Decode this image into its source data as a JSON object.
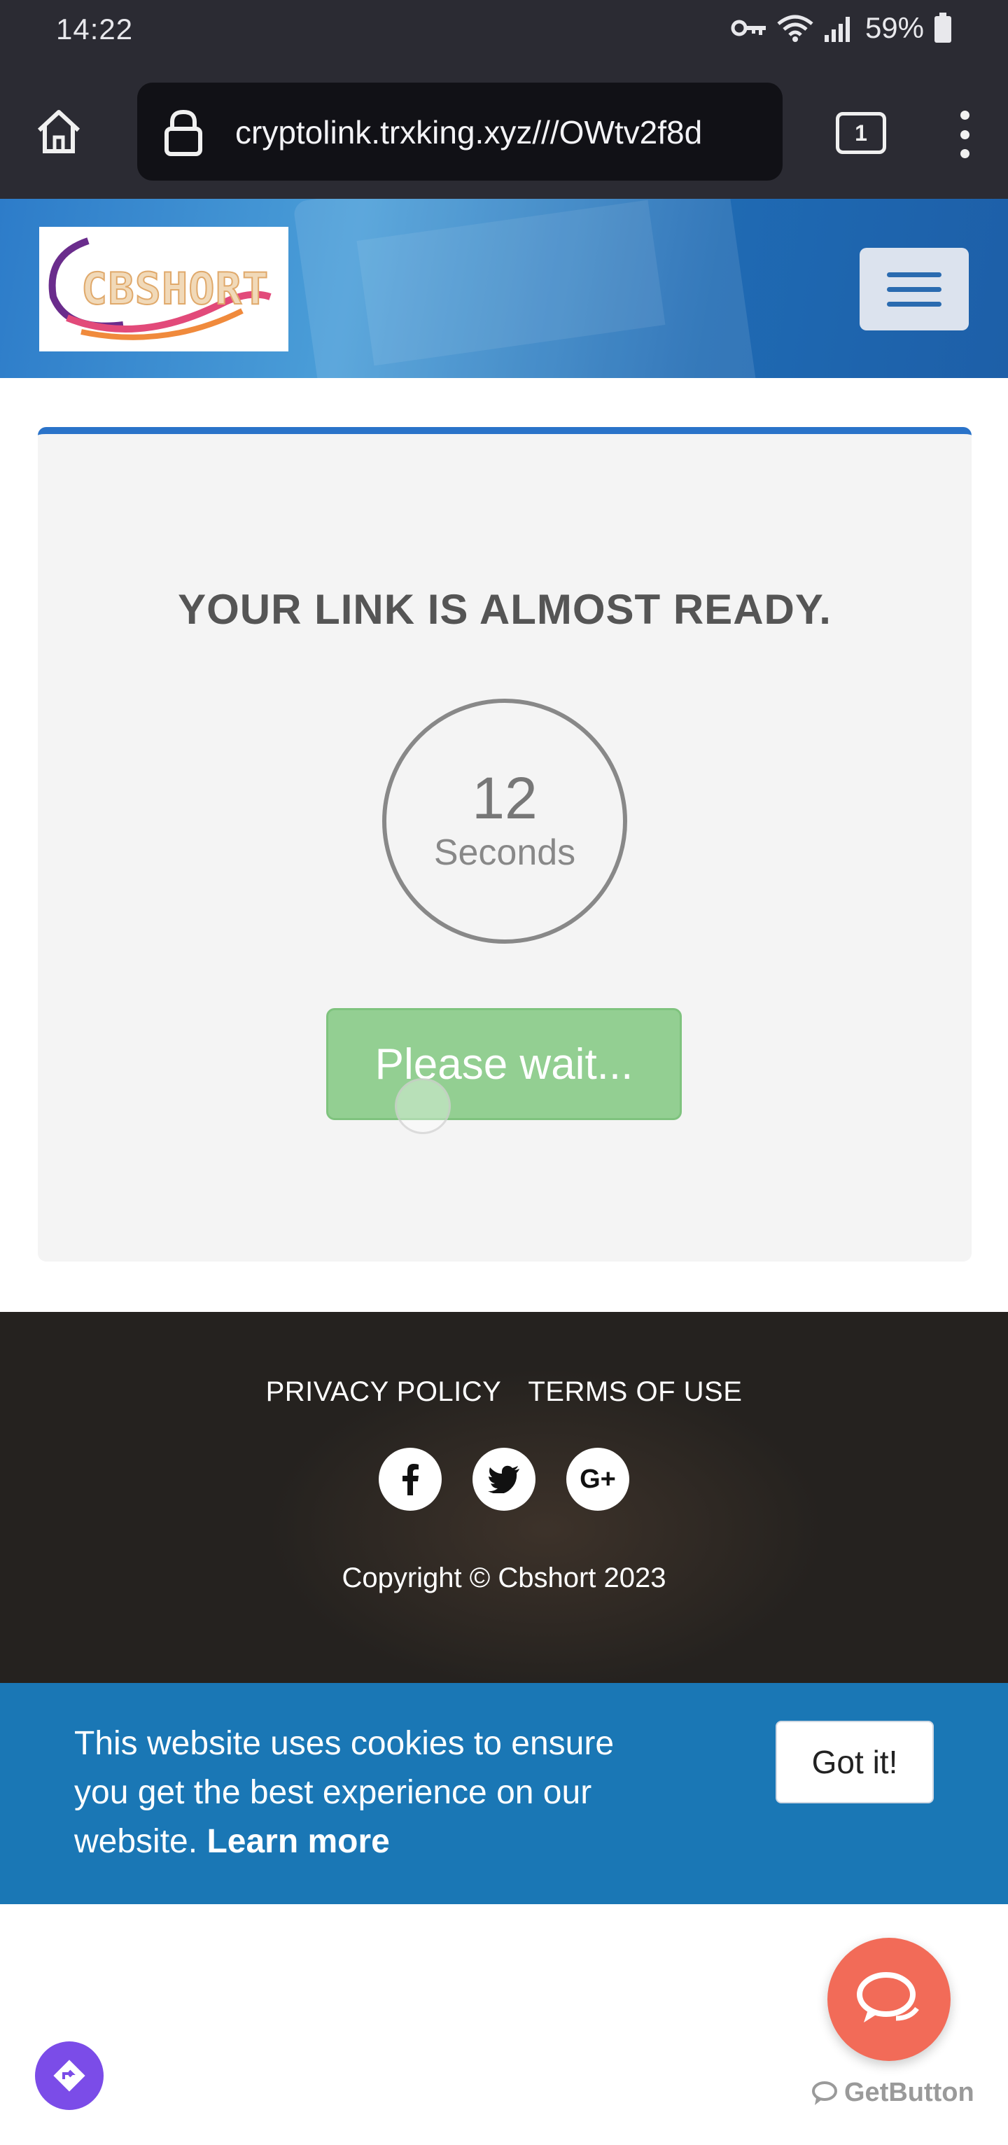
{
  "status_bar": {
    "time": "14:22",
    "battery": "59%",
    "icons": [
      "key-icon",
      "wifi-icon",
      "signal-icon",
      "battery-icon"
    ]
  },
  "browser": {
    "url": "cryptolink.trxking.xyz///OWtv2f8d",
    "tab_count": "1",
    "icons": [
      "home-icon",
      "lock-icon",
      "tabs-icon",
      "more-vert-icon"
    ]
  },
  "header": {
    "logo_text": "CBSHORT",
    "colors": {
      "background": "#2d7cc9",
      "menu_button": "#dce3ee"
    }
  },
  "card": {
    "title": "YOUR LINK IS ALMOST READY.",
    "timer_value": "12",
    "timer_label": "Seconds",
    "button_label": "Please wait...",
    "colors": {
      "accent": "#2a73c9",
      "button": "#93cf92"
    }
  },
  "footer": {
    "links": [
      "PRIVACY POLICY",
      "TERMS OF USE"
    ],
    "social": [
      "facebook-icon",
      "twitter-icon",
      "google-plus-icon"
    ],
    "google_plus_label": "G+",
    "copyright": "Copyright © Cbshort 2023"
  },
  "cookie_banner": {
    "text": "This website uses cookies to ensure you get the best experience on our website.",
    "learn_more": "Learn more",
    "button": "Got it!",
    "background": "#1a77b5"
  },
  "widgets": {
    "getbutton_label": "GetButton",
    "chat_color": "#f26b58",
    "nav_color": "#7b4ce8"
  }
}
